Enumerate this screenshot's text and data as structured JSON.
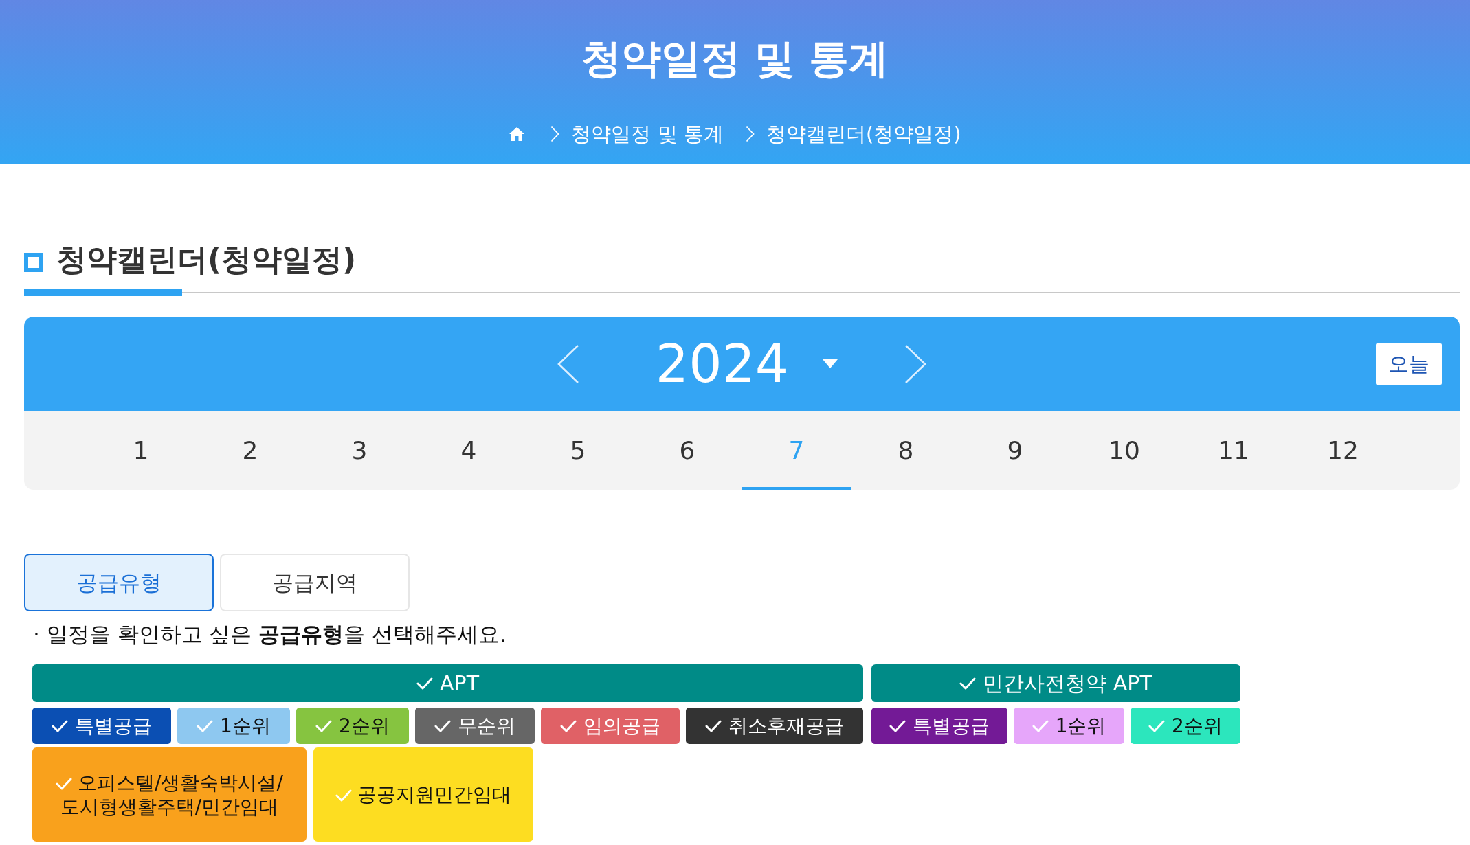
{
  "header": {
    "title": "청약일정 및 통계",
    "breadcrumb": [
      "청약일정 및 통계",
      "청약캘린더(청약일정)"
    ]
  },
  "section": {
    "title": "청약캘린더(청약일정)"
  },
  "calendar": {
    "year": "2024",
    "today_button": "오늘",
    "months": [
      {
        "label": "1",
        "selected": false
      },
      {
        "label": "2",
        "selected": false
      },
      {
        "label": "3",
        "selected": false
      },
      {
        "label": "4",
        "selected": false
      },
      {
        "label": "5",
        "selected": false
      },
      {
        "label": "6",
        "selected": false
      },
      {
        "label": "7",
        "selected": true
      },
      {
        "label": "8",
        "selected": false
      },
      {
        "label": "9",
        "selected": false
      },
      {
        "label": "10",
        "selected": false
      },
      {
        "label": "11",
        "selected": false
      },
      {
        "label": "12",
        "selected": false
      }
    ]
  },
  "tabs": [
    {
      "label": "공급유형",
      "selected": true
    },
    {
      "label": "공급지역",
      "selected": false
    }
  ],
  "instruction": "· 일정을 확인하고 싶은 **공급유형**을 선택해주세요.",
  "filters": {
    "groups": [
      {
        "label": "APT",
        "checked": true,
        "color": "#008b87",
        "items": [
          {
            "label": "특별공급",
            "checked": true,
            "color": "#0b4fb3"
          },
          {
            "label": "1순위",
            "checked": true,
            "color": "#8ec8f0"
          },
          {
            "label": "2순위",
            "checked": true,
            "color": "#86c440"
          },
          {
            "label": "무순위",
            "checked": true,
            "color": "#666666"
          },
          {
            "label": "임의공급",
            "checked": true,
            "color": "#e06166"
          },
          {
            "label": "취소후재공급",
            "checked": true,
            "color": "#333333"
          }
        ]
      },
      {
        "label": "민간사전청약 APT",
        "checked": true,
        "color": "#008b87",
        "items": [
          {
            "label": "특별공급",
            "checked": true,
            "color": "#731a96"
          },
          {
            "label": "1순위",
            "checked": true,
            "color": "#e6a6fa"
          },
          {
            "label": "2순위",
            "checked": true,
            "color": "#2ce6bd"
          }
        ]
      }
    ],
    "others": [
      {
        "label": "오피스텔/생활숙박시설/도시형생활주택/민간임대",
        "checked": true,
        "color": "#f9a11c"
      },
      {
        "label": "공공지원민간임대",
        "checked": true,
        "color": "#fddd21"
      }
    ]
  }
}
